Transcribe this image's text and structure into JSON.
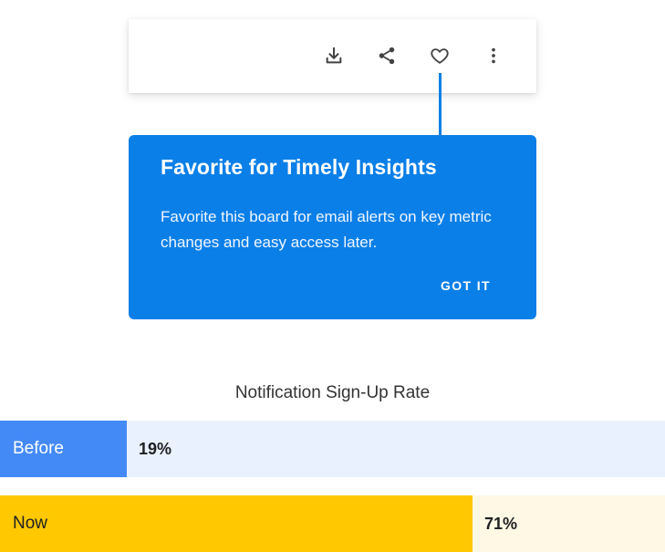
{
  "toolbar": {
    "buttons": [
      {
        "icon": "download-icon"
      },
      {
        "icon": "share-icon"
      },
      {
        "icon": "heart-icon"
      },
      {
        "icon": "more-vert-icon"
      }
    ]
  },
  "tooltip": {
    "title": "Favorite for Timely Insights",
    "body": "Favorite this board for email alerts on key metric changes and easy access later.",
    "button_label": "GOT IT",
    "color": "#0a7fe8"
  },
  "chart_data": {
    "type": "bar",
    "title": "Notification Sign-Up Rate",
    "categories": [
      "Before",
      "Now"
    ],
    "values": [
      19,
      71
    ],
    "value_labels": [
      "19%",
      "71%"
    ],
    "ylim": [
      0,
      100
    ],
    "colors": {
      "before_fill": "#448af7",
      "before_track": "#eaf1fe",
      "now_fill": "#ffc800",
      "now_track": "#fff8e5"
    }
  }
}
